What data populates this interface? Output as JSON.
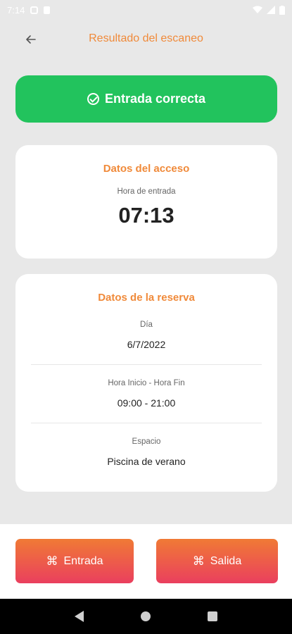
{
  "status_bar": {
    "time": "7:14"
  },
  "header": {
    "back_icon": "arrow-left-icon",
    "title": "Resultado del escaneo"
  },
  "banner": {
    "icon": "check-circle-icon",
    "text": "Entrada correcta",
    "color": "#22c35d"
  },
  "access_card": {
    "title": "Datos del acceso",
    "entry_label": "Hora de entrada",
    "entry_time": "07:13"
  },
  "booking_card": {
    "title": "Datos de la reserva",
    "day_label": "Día",
    "day_value": "6/7/2022",
    "hours_label": "Hora Inicio - Hora Fin",
    "hours_value": "09:00 - 21:00",
    "space_label": "Espacio",
    "space_value": "Piscina de verano"
  },
  "actions": {
    "entrada_label": "Entrada",
    "salida_label": "Salida",
    "icon": "qr-scan-icon"
  },
  "colors": {
    "accent": "#f08a3a",
    "gradient_top": "#f07a35",
    "gradient_bottom": "#ea3f5e"
  }
}
